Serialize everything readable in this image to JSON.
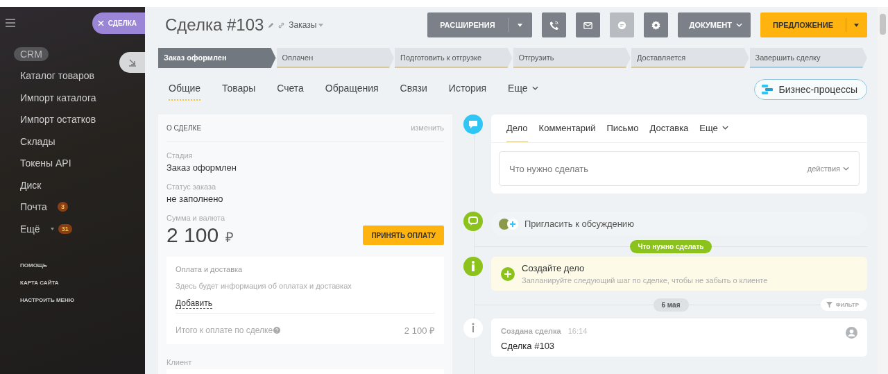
{
  "sidebar": {
    "panel_tab": "СДЕЛКА",
    "menu_items": [
      {
        "label": "CRM",
        "selected": true
      },
      {
        "label": "Каталог товаров",
        "selected": false
      },
      {
        "label": "Импорт каталога",
        "selected": false
      },
      {
        "label": "Импорт остатков",
        "selected": false
      },
      {
        "label": "Склады",
        "selected": false
      },
      {
        "label": "Токены API",
        "selected": false
      },
      {
        "label": "Диск",
        "selected": false
      },
      {
        "label": "Почта",
        "selected": false,
        "badge": "3"
      },
      {
        "label": "Ещё",
        "selected": false,
        "badge": "31",
        "dropdown": true
      }
    ],
    "links": [
      "ПОМОЩЬ",
      "КАРТА САЙТА",
      "НАСТРОИТЬ МЕНЮ"
    ]
  },
  "header": {
    "title": "Сделка #103",
    "category": "Заказы",
    "buttons": [
      {
        "kind": "split",
        "label": "РАСШИРЕНИЯ"
      },
      {
        "kind": "icon",
        "disabled": false
      },
      {
        "kind": "icon",
        "disabled": false
      },
      {
        "kind": "icon",
        "disabled": true
      },
      {
        "kind": "icon",
        "disabled": false
      },
      {
        "kind": "dropdown",
        "label": "ДОКУМЕНТ"
      },
      {
        "kind": "primary",
        "label": "ПРЕДЛОЖЕНИЕ"
      }
    ]
  },
  "stages": [
    {
      "label": "Заказ оформлен",
      "selected": true
    },
    {
      "label": "Оплачен",
      "selected": false
    },
    {
      "label": "Подготовить к отгрузке",
      "selected": false
    },
    {
      "label": "Отгрузить",
      "selected": false
    },
    {
      "label": "Доставляется",
      "selected": false
    },
    {
      "label": "Завершить сделку",
      "selected": false
    }
  ],
  "tabs": [
    {
      "label": "Общие",
      "selected": true
    },
    {
      "label": "Товары",
      "selected": false
    },
    {
      "label": "Счета",
      "selected": false
    },
    {
      "label": "Обращения",
      "selected": false
    },
    {
      "label": "Связи",
      "selected": false
    },
    {
      "label": "История",
      "selected": false
    },
    {
      "label": "Еще",
      "selected": false,
      "dropdown": true
    }
  ],
  "business_process_button": "Бизнес-процессы",
  "about": {
    "title": "О СДЕЛКЕ",
    "edit": "изменить",
    "fields": [
      {
        "label": "Стадия",
        "value": "Заказ оформлен"
      },
      {
        "label": "Статус заказа",
        "value": "не заполнено"
      }
    ],
    "amount_label": "Сумма и валюта",
    "amount": "2 100",
    "currency": "₽",
    "pay_button": "ПРИНЯТЬ ОПЛАТУ",
    "payment": {
      "title": "Оплата и доставка",
      "text": "Здесь будет информация об оплатах и доставках",
      "add_link": "Добавить",
      "total_label": "Итого к оплате по сделке",
      "total": "2 100 ₽"
    },
    "client_label": "Клиент"
  },
  "timeline": {
    "editor_tabs": [
      {
        "label": "Дело",
        "selected": true
      },
      {
        "label": "Комментарий",
        "selected": false
      },
      {
        "label": "Письмо",
        "selected": false
      },
      {
        "label": "Доставка",
        "selected": false
      },
      {
        "label": "Еще",
        "selected": false,
        "dropdown": true
      }
    ],
    "placeholder": "Что нужно сделать",
    "actions": "действия",
    "invite": "Пригласить к обсуждению",
    "section_badge": "Что нужно сделать",
    "create": {
      "title": "Создайте дело",
      "text": "Запланируйте следующий шаг по сделке, чтобы не забыть о клиенте"
    },
    "date": "6 мая",
    "filter": "ФИЛЬТР",
    "entry": {
      "title": "Создана сделка",
      "time": "16:14",
      "text": "Сделка #103"
    }
  }
}
